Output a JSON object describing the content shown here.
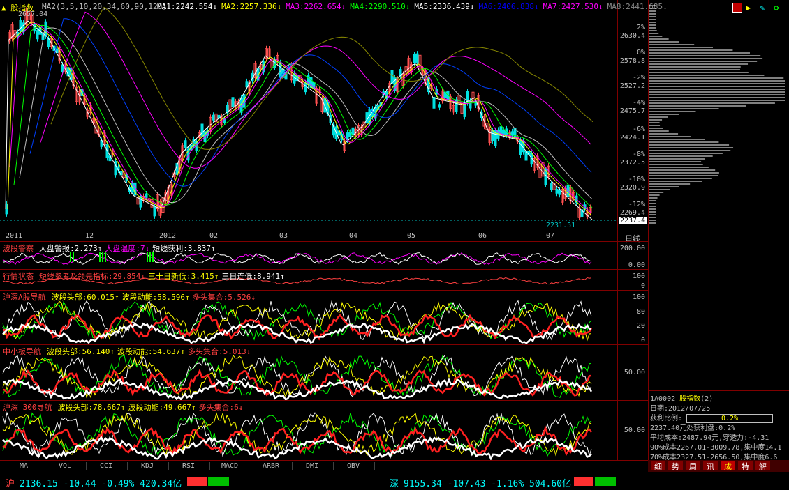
{
  "header": {
    "title": "股指数",
    "ma_params": "MA2(3,5,10,20,34,60,90,120)",
    "ma": [
      {
        "label": "MA1:2242.554↓",
        "color": "#ffffff"
      },
      {
        "label": "MA2:2257.336↓",
        "color": "#ffff00"
      },
      {
        "label": "MA3:2262.654↓",
        "color": "#ff00ff"
      },
      {
        "label": "MA4:2290.510↓",
        "color": "#00ff00"
      },
      {
        "label": "MA5:2336.439↓",
        "color": "#ffffff"
      },
      {
        "label": "MA6:2406.838↓",
        "color": "#0000ff"
      },
      {
        "label": "MA7:2427.530↓",
        "color": "#ff00ff"
      },
      {
        "label": "MA8:2441.685↓",
        "color": "#888888"
      }
    ]
  },
  "price_labels": {
    "high": "2657.04",
    "low": "2231.51",
    "current": "2237.4"
  },
  "price_axis": [
    "2630.4",
    "2578.8",
    "2527.2",
    "2475.7",
    "2424.1",
    "2372.5",
    "2320.9",
    "2269.4"
  ],
  "pct_axis": [
    "2%",
    "0%",
    "-2%",
    "-4%",
    "-6%",
    "-8%",
    "-10%",
    "-12%"
  ],
  "date_axis": [
    "2011",
    "12",
    "2012",
    "02",
    "03",
    "04",
    "05",
    "06",
    "07"
  ],
  "date_axis_label": "日线",
  "panels": [
    {
      "name": "波段警察",
      "color": "#ff4040",
      "labels": [
        {
          "text": "大盘警报:2.273↑",
          "color": "#ffffff"
        },
        {
          "text": "大盘温度:7↓",
          "color": "#ff00ff"
        },
        {
          "text": "短线获利:3.837↑",
          "color": "#ffffff"
        }
      ],
      "ticks": [
        "200.00",
        "0.00"
      ]
    },
    {
      "name": "行情状态",
      "color": "#ff4040",
      "labels": [
        {
          "text": "短线参考及领先指标:29.854↓",
          "color": "#ff4040"
        },
        {
          "text": "三十日新低:3.415↑",
          "color": "#ffff00"
        },
        {
          "text": "三日连低:8.941↑",
          "color": "#ffffff"
        }
      ],
      "ticks": [
        "100",
        "0"
      ]
    },
    {
      "name": "沪深A股导航",
      "color": "#ff4040",
      "labels": [
        {
          "text": "波段头部:60.015↑",
          "color": "#ffff00"
        },
        {
          "text": "波段动能:58.596↑",
          "color": "#ffff00"
        },
        {
          "text": "多头集合:5.526↓",
          "color": "#ff4040"
        }
      ],
      "ticks": [
        "100",
        "80",
        "20",
        "0"
      ]
    },
    {
      "name": "中小板导航",
      "color": "#ff4040",
      "labels": [
        {
          "text": "波段头部:56.140↑",
          "color": "#ffff00"
        },
        {
          "text": "波段动能:54.637↑",
          "color": "#ffff00"
        },
        {
          "text": "多头集合:5.013↓",
          "color": "#ff4040"
        }
      ],
      "ticks": [
        "50.00"
      ]
    },
    {
      "name": "沪深 300导航",
      "color": "#ff4040",
      "labels": [
        {
          "text": "波段头部:78.667↑",
          "color": "#ffff00"
        },
        {
          "text": "波段动能:49.667↑",
          "color": "#ffff00"
        },
        {
          "text": "多头集合:6↓",
          "color": "#ff4040"
        }
      ],
      "ticks": [
        "50.00"
      ]
    }
  ],
  "tabs": [
    "MA",
    "VOL",
    "CCI",
    "KDJ",
    "RSI",
    "MACD",
    "ARBR",
    "DMI",
    "OBV"
  ],
  "info": {
    "code": "1A0002",
    "name": "股指数",
    "suffix": "(2)",
    "date": "日期:2012/07/25",
    "ratio_label": "获利比例:",
    "ratio_value": "0.2%",
    "line1": "2237.40元处获利盘:0.2%",
    "line2": "平均成本:2487.94元,穿透力:-4.31",
    "line3": "90%成本2267.01-3009.78,集中度14.1",
    "line4": "70%成本2327.51-2656.50,集中度6.6"
  },
  "right_tabs": [
    "细",
    "势",
    "周",
    "讯",
    "成",
    "特",
    "解"
  ],
  "status": {
    "sh_label": "沪",
    "sh_text": "2136.15  -10.44 -0.49% 420.34亿",
    "sz_label": "深",
    "sz_text": "9155.34  -107.43 -1.16% 504.60亿"
  },
  "icons": [
    "chart-icon",
    "flag-icon",
    "tool-icon",
    "gear-icon"
  ]
}
